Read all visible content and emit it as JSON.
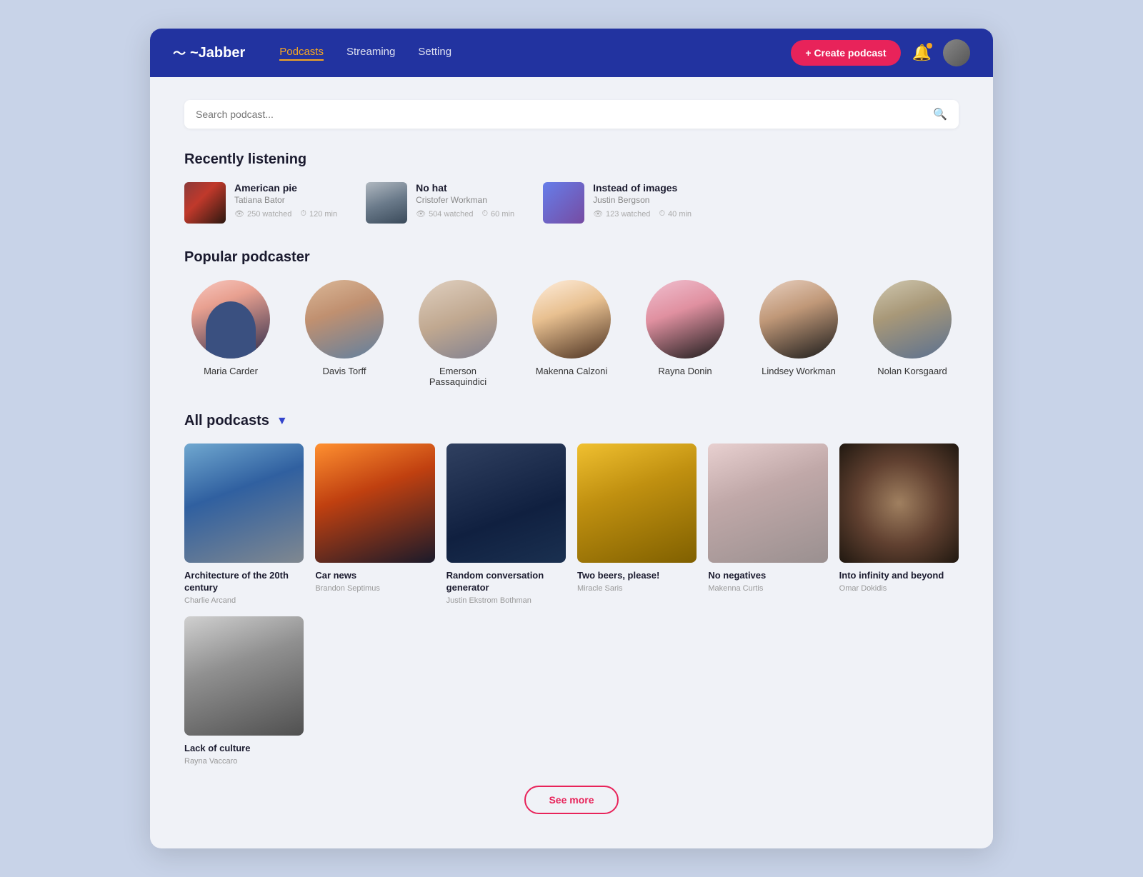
{
  "app": {
    "logo": "~Jabber",
    "logo_icon": "〜"
  },
  "navbar": {
    "links": [
      {
        "label": "Podcasts",
        "active": true
      },
      {
        "label": "Streaming",
        "active": false
      },
      {
        "label": "Setting",
        "active": false
      }
    ],
    "create_btn": "+ Create podcast",
    "bell_label": "Notifications",
    "avatar_label": "User avatar"
  },
  "search": {
    "placeholder": "Search podcast..."
  },
  "recently_listening": {
    "title": "Recently listening",
    "items": [
      {
        "title": "American pie",
        "author": "Tatiana Bator",
        "watched": "250 watched",
        "duration": "120 min",
        "thumb_class": "thumb-american-pie"
      },
      {
        "title": "No hat",
        "author": "Cristofer Workman",
        "watched": "504 watched",
        "duration": "60 min",
        "thumb_class": "thumb-no-hat"
      },
      {
        "title": "Instead of images",
        "author": "Justin Bergson",
        "watched": "123 watched",
        "duration": "40 min",
        "thumb_class": "thumb-images"
      }
    ]
  },
  "popular_podcasters": {
    "title": "Popular podcaster",
    "items": [
      {
        "name": "Maria Carder",
        "av_class": "av-maria"
      },
      {
        "name": "Davis Torff",
        "av_class": "av-davis"
      },
      {
        "name": "Emerson Passaquindici",
        "av_class": "av-emerson"
      },
      {
        "name": "Makenna Calzoni",
        "av_class": "av-makenna"
      },
      {
        "name": "Rayna Donin",
        "av_class": "av-rayna"
      },
      {
        "name": "Lindsey Workman",
        "av_class": "av-lindsey"
      },
      {
        "name": "Nolan Korsgaard",
        "av_class": "av-nolan"
      }
    ]
  },
  "all_podcasts": {
    "title": "All podcasts",
    "items": [
      {
        "title": "Architecture of the 20th century",
        "author": "Charlie Arcand",
        "thumb_class": "pt-arch"
      },
      {
        "title": "Car news",
        "author": "Brandon Septimus",
        "thumb_class": "pt-car"
      },
      {
        "title": "Random conversation generator",
        "author": "Justin Ekstrom Bothman",
        "thumb_class": "pt-random"
      },
      {
        "title": "Two beers, please!",
        "author": "Miracle Saris",
        "thumb_class": "pt-beers"
      },
      {
        "title": "No negatives",
        "author": "Makenna Curtis",
        "thumb_class": "pt-negative"
      },
      {
        "title": "Into infinity and beyond",
        "author": "Omar Dokidis",
        "thumb_class": "pt-infinity"
      },
      {
        "title": "Lack of culture",
        "author": "Rayna Vaccaro",
        "thumb_class": "pt-culture"
      }
    ],
    "see_more": "See more"
  }
}
